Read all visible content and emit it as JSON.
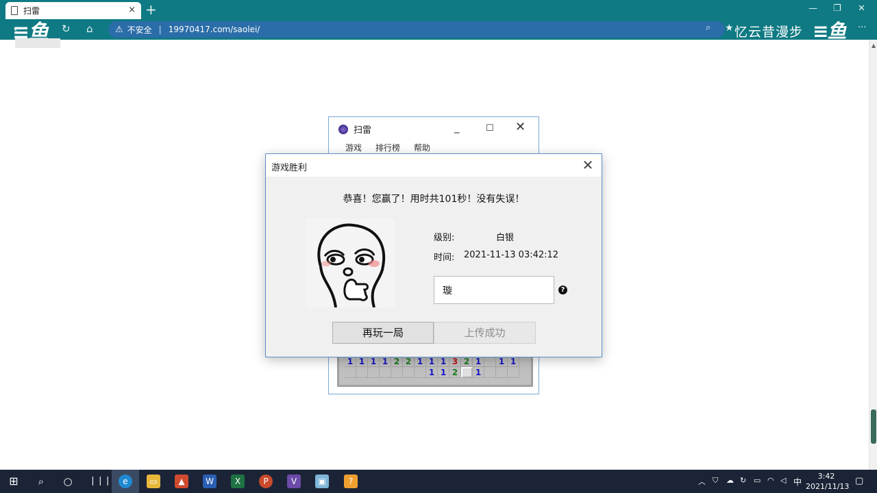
{
  "browser": {
    "tab_title": "扫雷",
    "tab_close": "×",
    "new_tab": "+",
    "security_label": "不安全",
    "url": "19970417.com/saolei/",
    "overlay_text": "忆云昔漫步"
  },
  "minesweeper": {
    "title": "扫雷",
    "menu": [
      "游戏",
      "排行榜",
      "帮助"
    ],
    "rows": [
      [
        "1",
        "1",
        "1",
        "1",
        "2",
        "2",
        "1",
        "1",
        "1",
        "3",
        "2",
        "1",
        "",
        "1",
        "1"
      ],
      [
        "",
        "",
        "",
        "",
        "",
        "",
        "",
        "1",
        "1",
        "2",
        "#",
        "1",
        "",
        "",
        ""
      ]
    ]
  },
  "dialog": {
    "title": "游戏胜利",
    "message": "恭喜！您赢了！用时共101秒！没有失误！",
    "level_label": "级别:",
    "level_value": "白银",
    "time_label": "时间:",
    "time_value": "2021-11-13 03:42:12",
    "name_value": "璇",
    "help": "?",
    "replay_button": "再玩一局",
    "upload_button": "上传成功"
  },
  "taskbar": {
    "input_method": "中",
    "time": "3:42",
    "date": "2021/11/13"
  },
  "colors": {
    "browser_chrome": "#0f7a83",
    "address_bar": "#2a6da8",
    "taskbar": "#1a2436",
    "dialog_border": "#5b8fc9"
  }
}
